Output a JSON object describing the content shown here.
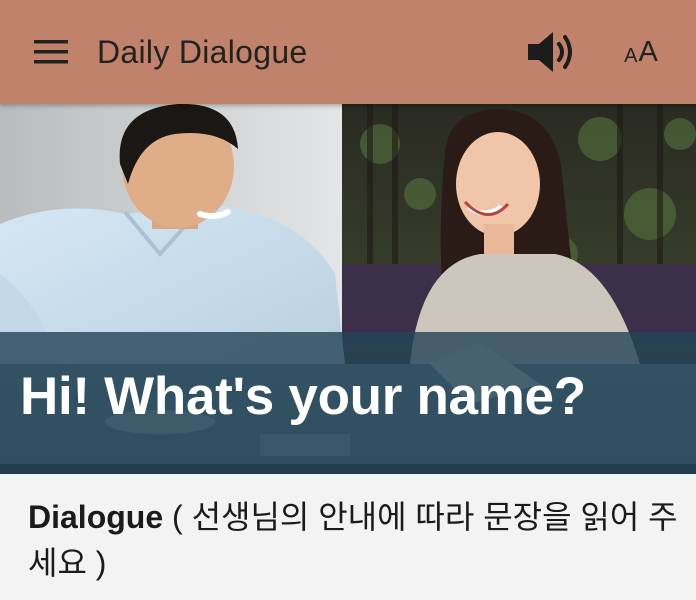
{
  "header": {
    "title": "Daily Dialogue",
    "menu_icon": "hamburger-menu-icon",
    "volume_icon": "speaker-volume-icon",
    "text_size_small": "A",
    "text_size_large": "A",
    "background_color": "#c0826a"
  },
  "hero": {
    "caption": "Hi! What's your name?",
    "band_color": "#244456"
  },
  "section": {
    "heading_bold": "Dialogue",
    "heading_rest": " ( 선생님의 안내에 따라 문장을 읽어 주세요 )"
  }
}
